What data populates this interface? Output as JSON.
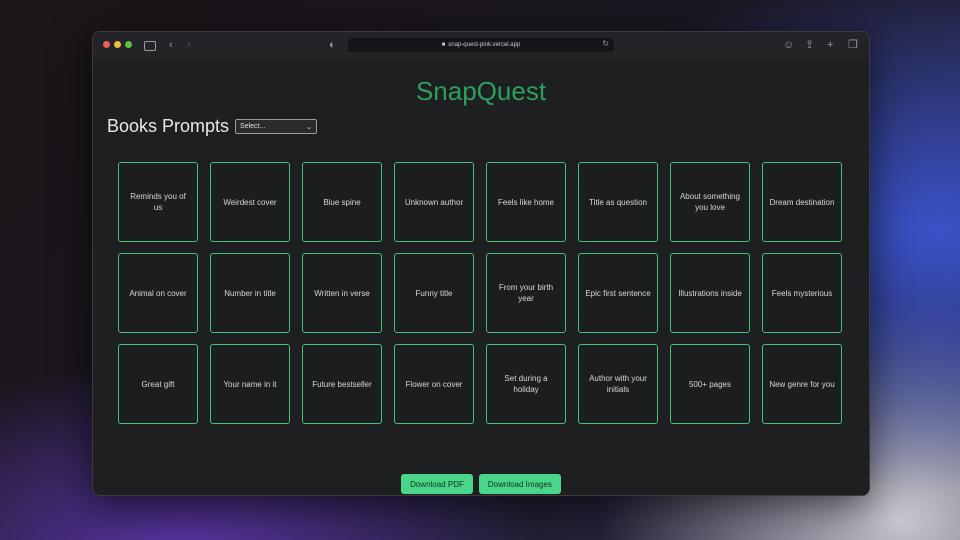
{
  "browser": {
    "url": "snap-quest-pink.vercel.app"
  },
  "app": {
    "title": "SnapQuest",
    "section_title": "Books Prompts",
    "select": {
      "value": "Select..."
    }
  },
  "prompts": [
    "Reminds you of us",
    "Weirdest cover",
    "Blue spine",
    "Unknown author",
    "Feels like home",
    "Title as question",
    "About something you love",
    "Dream destination",
    "Animal on cover",
    "Number in title",
    "Written in verse",
    "Funny title",
    "From your birth year",
    "Epic first sentence",
    "Illustrations inside",
    "Feels mysterious",
    "Great gift",
    "Your name in it",
    "Future bestseller",
    "Flower on cover",
    "Set during a holiday",
    "Author with your initials",
    "500+ pages",
    "New genre for you"
  ],
  "actions": {
    "download_pdf": "Download PDF",
    "download_images": "Download Images"
  },
  "colors": {
    "accent": "#4ad68a",
    "title": "#2e9e5e",
    "card_border": "#3fc27a"
  }
}
